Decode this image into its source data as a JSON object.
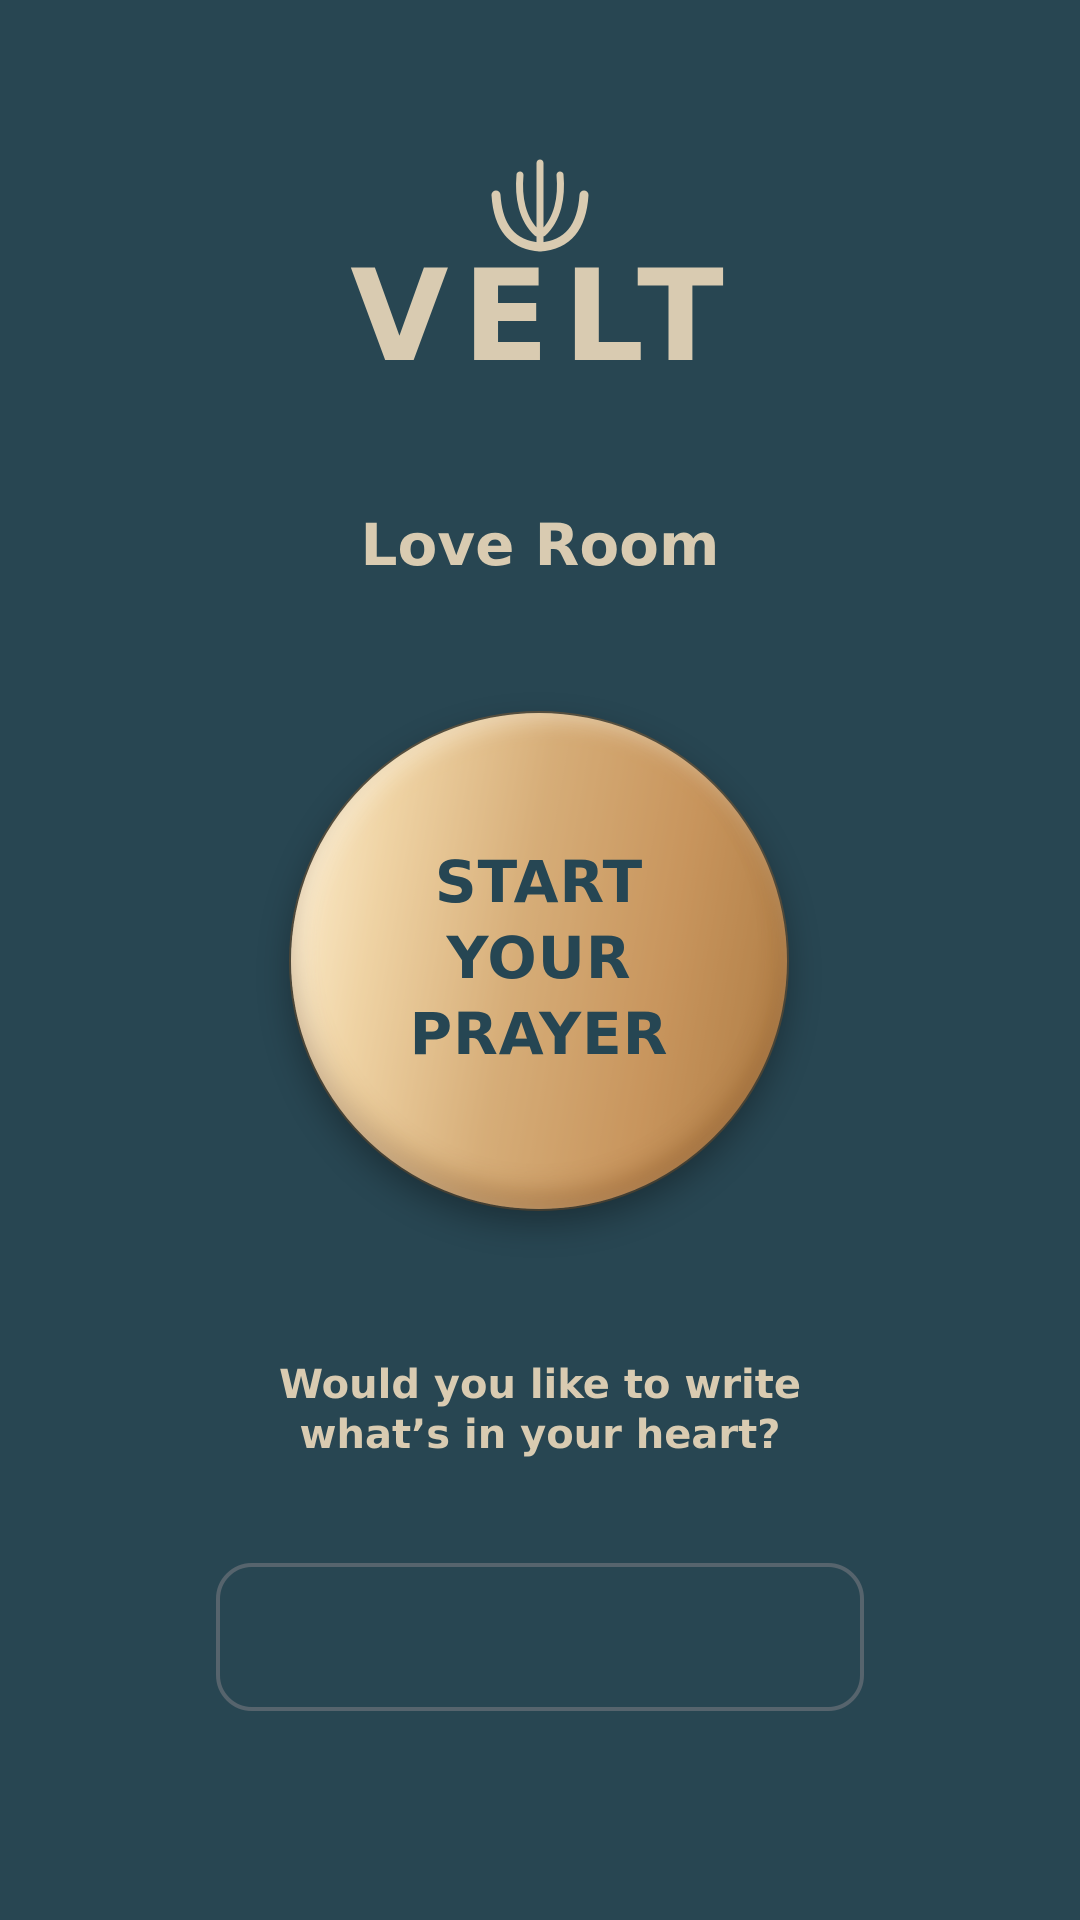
{
  "brand": {
    "name": "VELT",
    "logo_icon": "sprout-leaves-icon"
  },
  "room": {
    "title": "Love Room"
  },
  "prayer_button": {
    "label": "START\nYOUR\nPRAYER"
  },
  "write_prompt": {
    "text": "Would you like to write\nwhat’s in your heart?"
  },
  "heart_input": {
    "value": "",
    "placeholder": ""
  },
  "colors": {
    "background": "#284652",
    "cream_text": "#d9cbb1",
    "button_gold": "#d6ad78",
    "button_text": "#264653",
    "input_border": "#56646d"
  }
}
